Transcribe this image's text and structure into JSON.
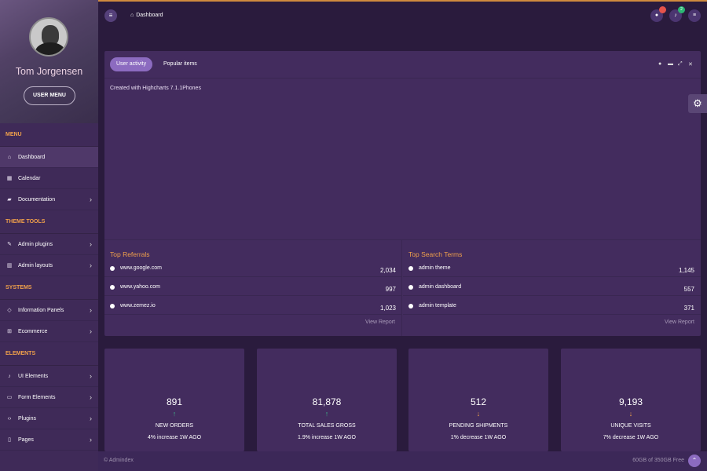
{
  "profile": {
    "name": "Tom Jorgensen",
    "menu_button": "USER MENU"
  },
  "sidebar": {
    "sections": [
      {
        "title": "MENU",
        "items": [
          {
            "label": "Dashboard",
            "icon": "home-icon",
            "active": true
          },
          {
            "label": "Calendar",
            "icon": "calendar-icon"
          },
          {
            "label": "Documentation",
            "icon": "book-icon",
            "chevron": true
          }
        ]
      },
      {
        "title": "THEME TOOLS",
        "items": [
          {
            "label": "Admin plugins",
            "icon": "pen-icon",
            "chevron": true
          },
          {
            "label": "Admin layouts",
            "icon": "layout-icon",
            "chevron": true
          }
        ]
      },
      {
        "title": "SYSTEMS",
        "items": [
          {
            "label": "Information Panels",
            "icon": "diamond-icon",
            "chevron": true
          },
          {
            "label": "Ecommerce",
            "icon": "cart-icon",
            "chevron": true
          }
        ]
      },
      {
        "title": "ELEMENTS",
        "items": [
          {
            "label": "UI Elements",
            "icon": "bell-icon",
            "chevron": true
          },
          {
            "label": "Form Elements",
            "icon": "inbox-icon",
            "chevron": true
          },
          {
            "label": "Plugins",
            "icon": "code-icon",
            "chevron": true
          },
          {
            "label": "Pages",
            "icon": "file-icon",
            "chevron": true
          }
        ]
      }
    ]
  },
  "header": {
    "breadcrumb": "Dashboard",
    "chat_badge": "",
    "bell_badge": "2",
    "colors": {
      "chat_badge": "#e5534b",
      "bell_badge": "#2bb673"
    }
  },
  "panel": {
    "tabs": [
      "User activity",
      "Popular items"
    ],
    "credit": "Created with Highcharts 7.1.1Phones",
    "referrals": {
      "title": "Top Referrals",
      "rows": [
        {
          "label": "www.google.com",
          "value": "2,034"
        },
        {
          "label": "www.yahoo.com",
          "value": "997"
        },
        {
          "label": "www.zemez.io",
          "value": "1,023"
        }
      ],
      "link": "View Report"
    },
    "search_terms": {
      "title": "Top Search Terms",
      "rows": [
        {
          "label": "admin theme",
          "value": "1,145"
        },
        {
          "label": "admin dashboard",
          "value": "557"
        },
        {
          "label": "admin template",
          "value": "371"
        }
      ],
      "link": "View Report"
    }
  },
  "stats": [
    {
      "value": "891",
      "arrow": "↑",
      "arrow_color": "#3fb68b",
      "title": "NEW ORDERS",
      "sub": "4% increase 1W AGO"
    },
    {
      "value": "81,878",
      "arrow": "↑",
      "arrow_color": "#3fb68b",
      "title": "TOTAL SALES GROSS",
      "sub": "1.9% increase 1W AGO"
    },
    {
      "value": "512",
      "arrow": "↓",
      "arrow_color": "#f0a04b",
      "title": "PENDING SHIPMENTS",
      "sub": "1% decrease 1W AGO"
    },
    {
      "value": "9,193",
      "arrow": "↓",
      "arrow_color": "#f0a04b",
      "title": "UNIQUE VISITS",
      "sub": "7% decrease 1W AGO"
    }
  ],
  "footer": {
    "copyright": "© Admindex",
    "storage": "60GB of 350GB Free"
  }
}
